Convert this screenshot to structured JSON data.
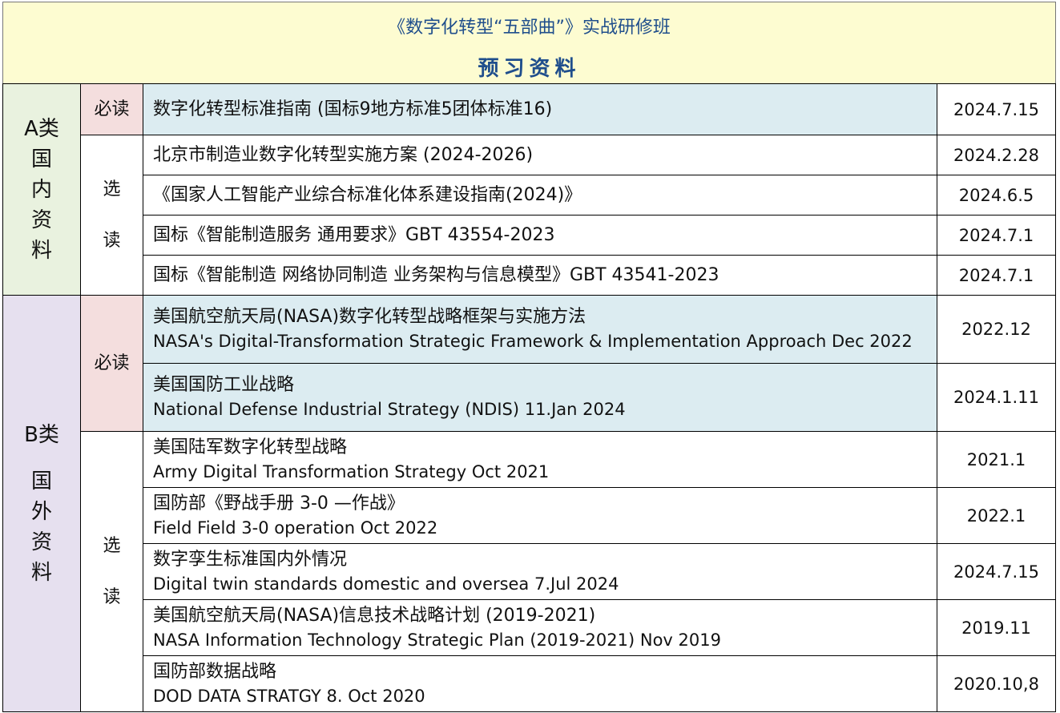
{
  "header": {
    "title": "《数字化转型“五部曲”》实战研修班",
    "subtitle": "预习资料"
  },
  "category_a": {
    "label_line1": "A类",
    "label_line2": "国",
    "label_line3": "内",
    "label_line4": "资",
    "label_line5": "料",
    "required_label": "必读",
    "optional_label_1": "选",
    "optional_label_2": "读",
    "rows": [
      {
        "title": "数字化转型标准指南 (国标9地方标准5团体标准16)",
        "date": "2024.7.15"
      },
      {
        "title": "北京市制造业数字化转型实施方案 (2024-2026)",
        "date": "2024.2.28"
      },
      {
        "title": "《国家人工智能产业综合标准化体系建设指南(2024)》",
        "date": "2024.6.5"
      },
      {
        "title": "国标《智能制造服务 通用要求》GBT 43554-2023",
        "date": "2024.7.1"
      },
      {
        "title": "国标《智能制造 网络协同制造 业务架构与信息模型》GBT 43541-2023",
        "date": "2024.7.1"
      }
    ]
  },
  "category_b": {
    "label_line1": "B类",
    "label_line2": "国",
    "label_line3": "外",
    "label_line4": "资",
    "label_line5": "料",
    "required_label": "必读",
    "optional_label_1": "选",
    "optional_label_2": "读",
    "rows": [
      {
        "title_zh": "美国航空航天局(NASA)数字化转型战略框架与实施方法",
        "title_en": "NASA's Digital-Transformation Strategic Framework & Implementation Approach Dec 2022",
        "date": "2022.12"
      },
      {
        "title_zh": "美国国防工业战略",
        "title_en": "National Defense Industrial Strategy (NDIS) 11.Jan 2024",
        "date": "2024.1.11"
      },
      {
        "title_zh": "美国陆军数字化转型战略",
        "title_en": "Army Digital Transformation Strategy Oct 2021",
        "date": "2021.1"
      },
      {
        "title_zh": "国防部《野战手册 3-0 —作战》",
        "title_en": "Field Field 3-0 operation  Oct 2022",
        "date": "2022.1"
      },
      {
        "title_zh": "数字孪生标准国内外情况",
        "title_en": "Digital twin standards domestic and oversea 7.Jul 2024",
        "date": "2024.7.15"
      },
      {
        "title_zh": "美国航空航天局(NASA)信息技术战略计划 (2019-2021)",
        "title_en": "NASA Information Technology Strategic Plan (2019-2021) Nov 2019",
        "date": "2019.11"
      },
      {
        "title_zh": "国防部数据战略",
        "title_en": "DOD DATA STRATGY 8. Oct 2020",
        "date": "2020.10,8"
      }
    ]
  },
  "colors": {
    "header_bg": "#fdfcd1",
    "header_text": "#1f4e8c",
    "category_a_bg": "#e9f2df",
    "category_b_bg": "#e6e0ef",
    "required_bg": "#f4dede",
    "highlight_row_bg": "#dcecf1"
  }
}
